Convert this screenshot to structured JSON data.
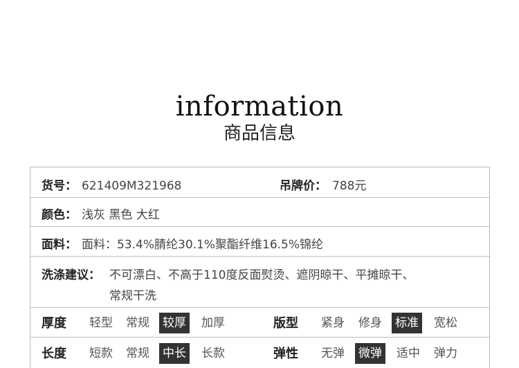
{
  "header": {
    "title_en": "information",
    "title_cn": "商品信息"
  },
  "info": {
    "sku_label": "货号：",
    "sku_value": "621409M321968",
    "price_label": "吊牌价：",
    "price_value": "788元",
    "color_label": "颜色：",
    "color_value": "浅灰 黑色 大红",
    "fabric_label": "面料：",
    "fabric_value": "面料：53.4%腈纶30.1%聚酯纤维16.5%锦纶",
    "wash_label": "洗涤建议：",
    "wash_line1": "不可漂白、不高于110度反面熨烫、遮阴晾干、平摊晾干、",
    "wash_line2": "常规干洗"
  },
  "attributes": {
    "thickness": {
      "label": "厚度",
      "options": [
        "轻型",
        "常规",
        "较厚",
        "加厚"
      ],
      "selected": "较厚"
    },
    "fit": {
      "label": "版型",
      "options": [
        "紧身",
        "修身",
        "标准",
        "宽松"
      ],
      "selected": "标准"
    },
    "length": {
      "label": "长度",
      "options": [
        "短款",
        "常规",
        "中长",
        "长款"
      ],
      "selected": "中长"
    },
    "elasticity": {
      "label": "弹性",
      "options": [
        "无弹",
        "微弹",
        "适中",
        "弹力"
      ],
      "selected": "微弹"
    }
  },
  "colors": {
    "selected_bg": "#333333",
    "border": "#bdbdbd"
  }
}
